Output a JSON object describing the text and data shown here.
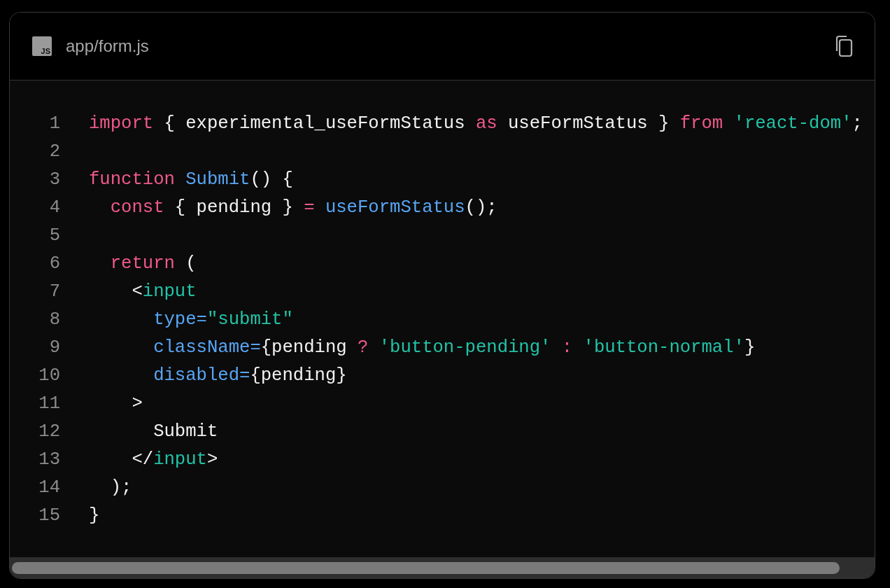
{
  "file": {
    "icon_text": "JS",
    "name": "app/form.js"
  },
  "lines": [
    {
      "number": "1",
      "tokens": [
        {
          "text": "import",
          "kind": "keyword"
        },
        {
          "text": " { experimental_useFormStatus ",
          "kind": "plain"
        },
        {
          "text": "as",
          "kind": "keyword"
        },
        {
          "text": " useFormStatus } ",
          "kind": "plain"
        },
        {
          "text": "from",
          "kind": "keyword"
        },
        {
          "text": " 'react-dom'",
          "kind": "string"
        },
        {
          "text": ";",
          "kind": "plain"
        }
      ]
    },
    {
      "number": "2"
    },
    {
      "number": "3",
      "tokens": [
        {
          "text": "function",
          "kind": "keyword"
        },
        {
          "text": " Submit",
          "kind": "name"
        },
        {
          "text": "() {",
          "kind": "plain"
        }
      ]
    },
    {
      "number": "4",
      "tokens": [
        {
          "text": "  const",
          "kind": "keyword"
        },
        {
          "text": " { pending } ",
          "kind": "plain"
        },
        {
          "text": "=",
          "kind": "keyword"
        },
        {
          "text": " useFormStatus",
          "kind": "name"
        },
        {
          "text": "();",
          "kind": "plain"
        }
      ]
    },
    {
      "number": "5"
    },
    {
      "number": "6",
      "tokens": [
        {
          "text": "  return",
          "kind": "keyword"
        },
        {
          "text": " (",
          "kind": "plain"
        }
      ]
    },
    {
      "number": "7",
      "tokens": [
        {
          "text": "    <",
          "kind": "plain"
        },
        {
          "text": "input",
          "kind": "string"
        }
      ]
    },
    {
      "number": "8",
      "tokens": [
        {
          "text": "      type=",
          "kind": "name"
        },
        {
          "text": "\"submit\"",
          "kind": "string"
        }
      ]
    },
    {
      "number": "9",
      "tokens": [
        {
          "text": "      className=",
          "kind": "name"
        },
        {
          "text": "{pending ",
          "kind": "plain"
        },
        {
          "text": "?",
          "kind": "keyword"
        },
        {
          "text": " 'button-pending'",
          "kind": "string"
        },
        {
          "text": " :",
          "kind": "keyword"
        },
        {
          "text": " 'button-normal'",
          "kind": "string"
        },
        {
          "text": "}",
          "kind": "plain"
        }
      ]
    },
    {
      "number": "10",
      "tokens": [
        {
          "text": "      disabled=",
          "kind": "name"
        },
        {
          "text": "{pending}",
          "kind": "plain"
        }
      ]
    },
    {
      "number": "11",
      "tokens": [
        {
          "text": "    >",
          "kind": "plain"
        }
      ]
    },
    {
      "number": "12",
      "tokens": [
        {
          "text": "      Submit",
          "kind": "plain"
        }
      ]
    },
    {
      "number": "13",
      "tokens": [
        {
          "text": "    </",
          "kind": "plain"
        },
        {
          "text": "input",
          "kind": "string"
        },
        {
          "text": ">",
          "kind": "plain"
        }
      ]
    },
    {
      "number": "14",
      "tokens": [
        {
          "text": "  );",
          "kind": "plain"
        }
      ]
    },
    {
      "number": "15",
      "tokens": [
        {
          "text": "}",
          "kind": "plain"
        }
      ]
    }
  ]
}
